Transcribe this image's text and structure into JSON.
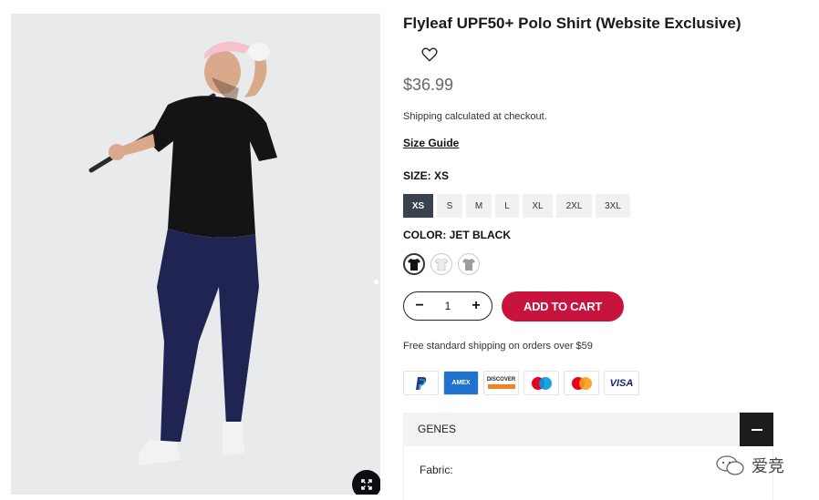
{
  "product": {
    "title": "Flyleaf UPF50+ Polo Shirt (Website Exclusive)",
    "price": "$36.99",
    "shipping_note": "Shipping calculated at checkout.",
    "size_guide": "Size Guide"
  },
  "size": {
    "label": "SIZE: XS",
    "options": [
      "XS",
      "S",
      "M",
      "L",
      "XL",
      "2XL",
      "3XL"
    ],
    "selected": "XS"
  },
  "color": {
    "label": "COLOR: JET BLACK",
    "options": [
      "jet-black",
      "white",
      "grey"
    ],
    "selected": "jet-black"
  },
  "quantity": {
    "minus": "−",
    "value": "1",
    "plus": "+"
  },
  "cart": {
    "label": "ADD TO CART"
  },
  "free_shipping": "Free standard shipping on orders over $59",
  "payments": [
    "PayPal",
    "AMEX",
    "DISCOVER",
    "Maestro",
    "Mastercard",
    "VISA"
  ],
  "accordion": {
    "title": "GENES",
    "fabric_label": "Fabric:"
  },
  "watermark": {
    "text": "爱竞"
  },
  "colors": {
    "accent": "#c8143c",
    "selected_size_bg": "#3a4250",
    "accordion_toggle": "#1c1c1c"
  }
}
